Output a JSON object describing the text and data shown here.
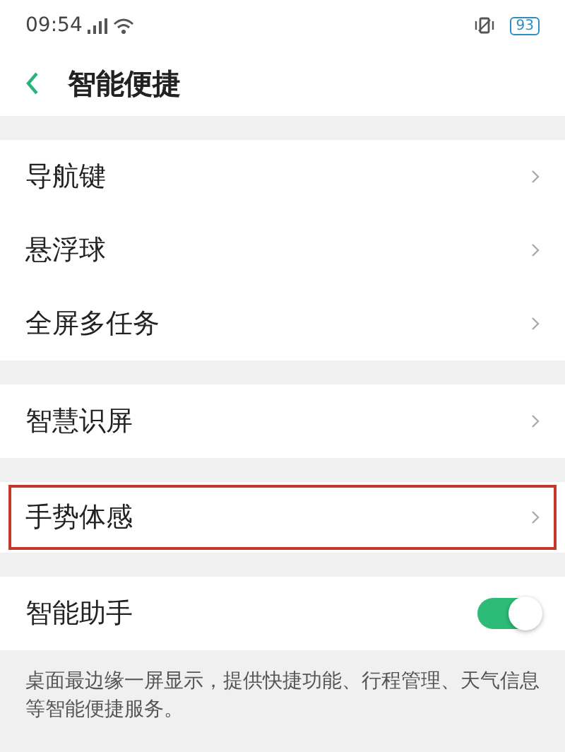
{
  "status_bar": {
    "time": "09:54",
    "battery": "93"
  },
  "header": {
    "title": "智能便捷"
  },
  "groups": [
    {
      "items": [
        {
          "kind": "link",
          "label": "导航键",
          "highlighted": false
        },
        {
          "kind": "link",
          "label": "悬浮球",
          "highlighted": false
        },
        {
          "kind": "link",
          "label": "全屏多任务",
          "highlighted": false
        }
      ]
    },
    {
      "items": [
        {
          "kind": "link",
          "label": "智慧识屏",
          "highlighted": false
        }
      ]
    },
    {
      "items": [
        {
          "kind": "link",
          "label": "手势体感",
          "highlighted": true
        }
      ]
    },
    {
      "items": [
        {
          "kind": "toggle",
          "label": "智能助手",
          "on": true
        }
      ]
    }
  ],
  "footer_note": "桌面最边缘一屏显示，提供快捷功能、行程管理、天气信息等智能便捷服务。"
}
